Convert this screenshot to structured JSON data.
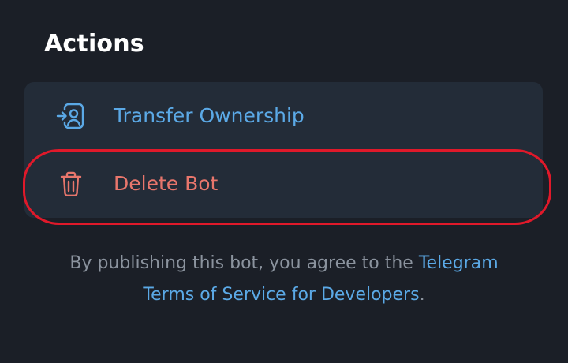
{
  "actions": {
    "title": "Actions",
    "items": [
      {
        "label": "Transfer Ownership",
        "icon": "transfer-user-icon",
        "color": "#5ba9e6"
      },
      {
        "label": "Delete Bot",
        "icon": "trash-icon",
        "color": "#e8766c"
      }
    ]
  },
  "footer": {
    "text": "By publishing this bot, you agree to the",
    "link_text": "Telegram Terms of Service for Developers",
    "suffix": "."
  },
  "theme": {
    "background": "#1b1f27",
    "card": "#232c38",
    "accent": "#5ba9e6",
    "danger": "#e8766c",
    "highlight": "#e0192a"
  }
}
